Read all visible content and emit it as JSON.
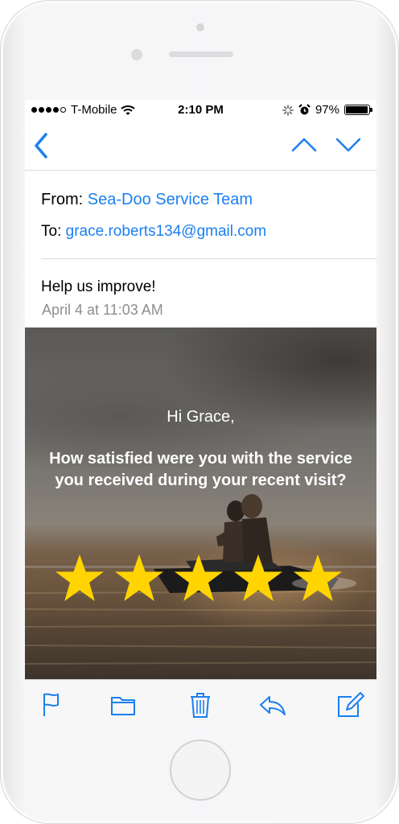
{
  "status_bar": {
    "carrier": "T-Mobile",
    "time": "2:10 PM",
    "battery_percent": "97%",
    "battery_level": 0.97,
    "signal_bars_filled": 4,
    "signal_bars_total": 5,
    "icons": [
      "wifi-icon",
      "activity-spinner-icon",
      "alarm-icon",
      "battery-icon"
    ]
  },
  "nav": {
    "icons": [
      "back-chevron-icon",
      "previous-message-icon",
      "next-message-icon"
    ],
    "accent_color": "#1b7ff0"
  },
  "email": {
    "from_label": "From:",
    "from_value": "Sea-Doo Service Team",
    "to_label": "To:",
    "to_value": "grace.roberts134@gmail.com",
    "subject": "Help us improve!",
    "date": "April 4 at 11:03 AM"
  },
  "body": {
    "greeting": "Hi Grace,",
    "question": "How satisfied were you with the service you received during your recent visit?",
    "star_count": 5,
    "star_color": "#ffd400"
  },
  "toolbar": {
    "icons": [
      "flag-icon",
      "folder-icon",
      "trash-icon",
      "reply-icon",
      "compose-icon"
    ]
  }
}
